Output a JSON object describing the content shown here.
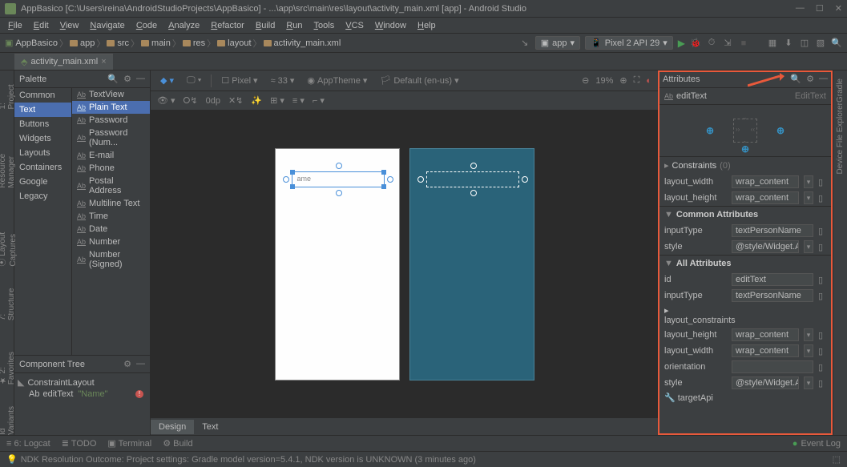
{
  "title": "AppBasico [C:\\Users\\reina\\AndroidStudioProjects\\AppBasico] - ...\\app\\src\\main\\res\\layout\\activity_main.xml [app] - Android Studio",
  "menu": [
    "File",
    "Edit",
    "View",
    "Navigate",
    "Code",
    "Analyze",
    "Refactor",
    "Build",
    "Run",
    "Tools",
    "VCS",
    "Window",
    "Help"
  ],
  "breadcrumbs": [
    "AppBasico",
    "app",
    "src",
    "main",
    "res",
    "layout",
    "activity_main.xml"
  ],
  "run_config": "app",
  "device_combo": "Pixel 2 API 29",
  "tab_name": "activity_main.xml",
  "palette": {
    "title": "Palette",
    "categories": [
      "Common",
      "Text",
      "Buttons",
      "Widgets",
      "Layouts",
      "Containers",
      "Google",
      "Legacy"
    ],
    "active_cat": "Text",
    "items": [
      "TextView",
      "Plain Text",
      "Password",
      "Password (Num...",
      "E-mail",
      "Phone",
      "Postal Address",
      "Multiline Text",
      "Time",
      "Date",
      "Number",
      "Number (Signed)"
    ],
    "active_item": "Plain Text"
  },
  "comp_tree": {
    "title": "Component Tree",
    "root": "ConstraintLayout",
    "child": "editText",
    "child_val": "\"Name\""
  },
  "design_toolbar": {
    "device": "Pixel",
    "api": "33",
    "theme": "AppTheme",
    "locale": "Default (en-us)",
    "zoom": "19%",
    "odp": "0dp"
  },
  "edit_label": "ame",
  "design_tabs": [
    "Design",
    "Text"
  ],
  "attrs": {
    "title": "Attributes",
    "id": "editText",
    "type": "EditText",
    "constraints": {
      "label": "Constraints",
      "count": "(0)"
    },
    "rows1": [
      {
        "k": "layout_width",
        "v": "wrap_content",
        "dd": true
      },
      {
        "k": "layout_height",
        "v": "wrap_content",
        "dd": true
      }
    ],
    "common_label": "Common Attributes",
    "rows2": [
      {
        "k": "inputType",
        "v": "textPersonName"
      },
      {
        "k": "style",
        "v": "@style/Widget.App",
        "dd": true
      }
    ],
    "all_label": "All Attributes",
    "rows3": [
      {
        "k": "id",
        "v": "editText"
      },
      {
        "k": "inputType",
        "v": "textPersonName"
      },
      {
        "k": "layout_constraints",
        "v": "",
        "arrow": true
      },
      {
        "k": "layout_height",
        "v": "wrap_content",
        "dd": true
      },
      {
        "k": "layout_width",
        "v": "wrap_content",
        "dd": true
      },
      {
        "k": "orientation",
        "v": ""
      },
      {
        "k": "style",
        "v": "@style/Widget.App",
        "dd": true
      },
      {
        "k": "targetApi",
        "v": "",
        "wrench": true
      }
    ]
  },
  "bottom": [
    "Logcat",
    "TODO",
    "Terminal",
    "Build"
  ],
  "bottom_prefix": [
    "≡ 6:",
    "≣",
    "▣",
    "⚙"
  ],
  "event_log": "Event Log",
  "status_msg": "NDK Resolution Outcome: Project settings: Gradle model version=5.4.1, NDK version is UNKNOWN (3 minutes ago)",
  "left_gutter": [
    "1: Project",
    "Resource Manager",
    "⦿ Layout Captures",
    "7: Structure",
    "★ 2: Favorites",
    "Id Variants"
  ],
  "right_gutter": [
    "Gradle",
    "Device File Explorer"
  ]
}
